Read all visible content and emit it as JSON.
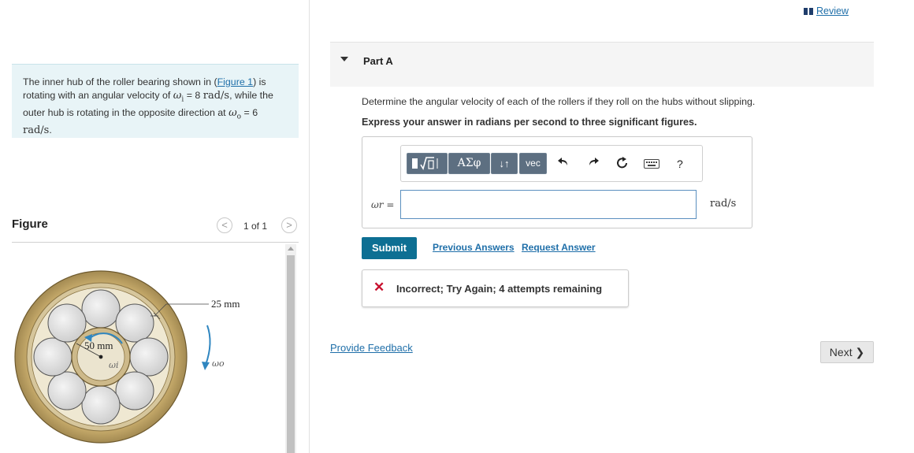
{
  "problem": {
    "text_1": "The inner hub of the roller bearing shown in (",
    "figure_link": "Figure 1",
    "text_2": ") is rotating with an angular velocity of ",
    "omega_i": "ω",
    "omega_i_sub": "i",
    "eq_1": " = 8 ",
    "unit_1": "rad/s",
    "text_3": ", while the outer hub is rotating in the opposite direction at ",
    "omega_o": "ω",
    "omega_o_sub": "o",
    "eq_2": " = 6 ",
    "unit_2": "rad/s",
    "text_4": "."
  },
  "figure": {
    "heading": "Figure",
    "counter": "1 of 1",
    "prev_glyph": "<",
    "next_glyph": ">",
    "label_25mm": "25 mm",
    "label_50mm": "50 mm",
    "label_omega_i": "ωi",
    "label_omega_o": "ωo",
    "colors": {
      "outer_ring": "#b59a5f",
      "ring_light": "#dccfa8",
      "roller": "#e4e4e4",
      "arrow": "#2f86c0"
    }
  },
  "header": {
    "review_label": "Review"
  },
  "part": {
    "title": "Part A",
    "question": "Determine the angular velocity of each of the rollers if they roll on the hubs without slipping.",
    "instruction": "Express your answer in radians per second to three significant figures."
  },
  "toolbar": {
    "greek_label": "ΑΣφ",
    "sort_label": "↓↑",
    "vec_label": "vec",
    "undo_icon": "undo-icon",
    "redo_icon": "redo-icon",
    "reset_icon": "reset-icon",
    "keyboard_icon": "keyboard-icon",
    "help_label": "?"
  },
  "answer": {
    "variable": "ωr =",
    "value": "",
    "unit": "rad/s"
  },
  "actions": {
    "submit_label": "Submit",
    "previous_answers": "Previous Answers",
    "request_answer": "Request Answer"
  },
  "feedback": {
    "icon": "x-icon",
    "message": "Incorrect; Try Again; 4 attempts remaining"
  },
  "footer": {
    "provide_feedback": "Provide Feedback",
    "next_label": "Next ❯"
  },
  "colors": {
    "link": "#1f6fa9",
    "submit": "#0d6f93",
    "error": "#c8102e",
    "problem_bg": "#e8f4f7"
  }
}
